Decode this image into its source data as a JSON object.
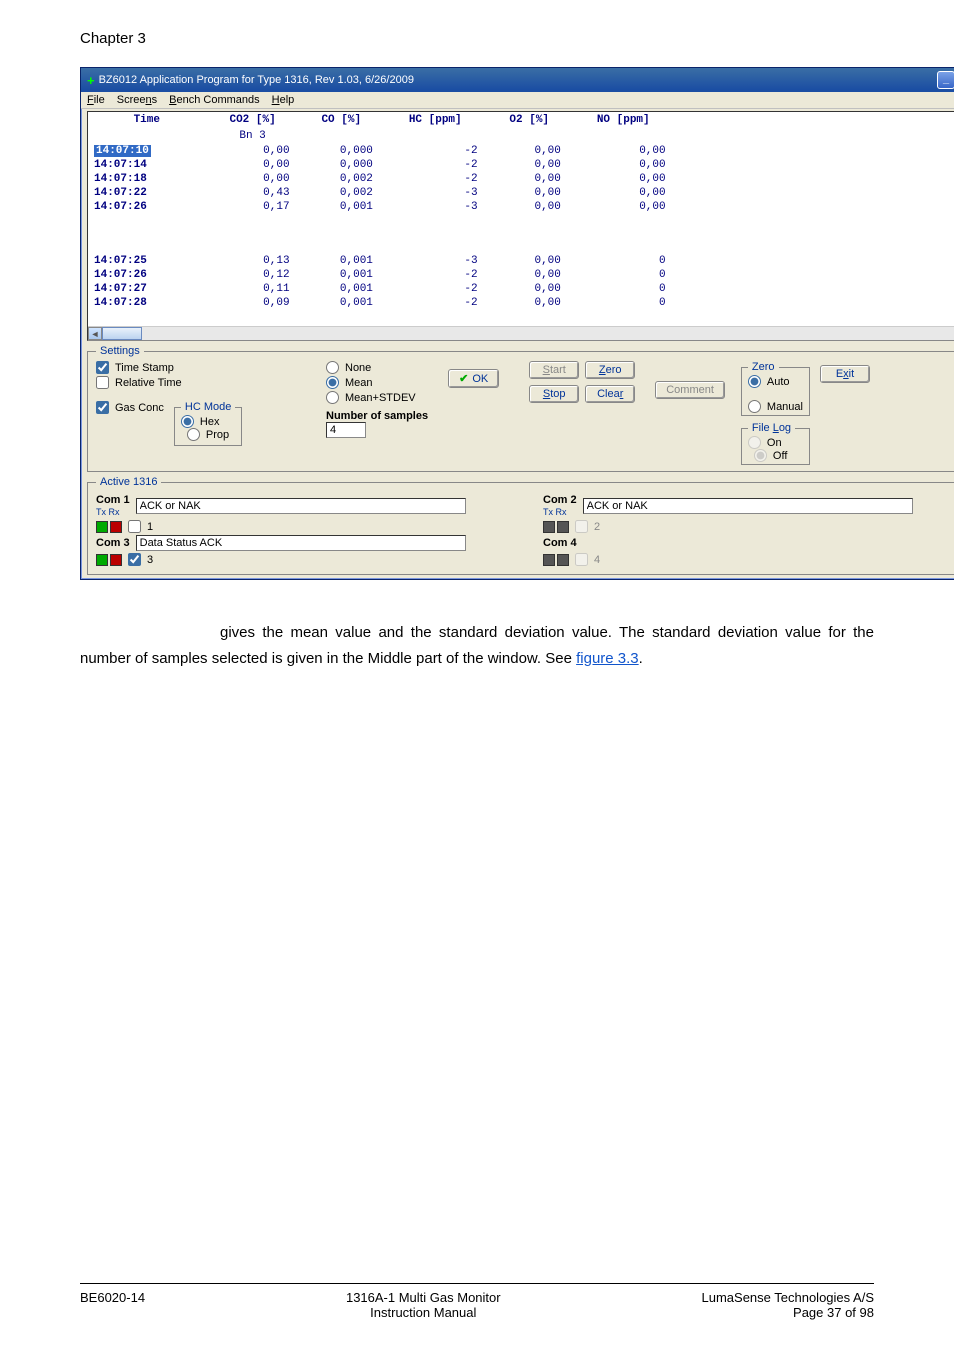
{
  "chapter_label": "Chapter 3",
  "window": {
    "title": "BZ6012 Application Program for Type 1316, Rev 1.03, 6/26/2009",
    "menu": {
      "file": "File",
      "screens": "Screens",
      "bench": "Bench Commands",
      "help": "Help"
    }
  },
  "grid": {
    "headers": {
      "time": "Time",
      "co2": "CO2 [%]",
      "co2sub": "Bn 3",
      "co": "CO [%]",
      "hc": "HC [ppm]",
      "o2": "O2 [%]",
      "no": "NO [ppm]"
    },
    "rows_top": [
      {
        "time": "14:07:10",
        "sel": true,
        "co2": "0,00",
        "co": "0,000",
        "hc": "-2",
        "o2": "0,00",
        "no": "0,00"
      },
      {
        "time": "14:07:14",
        "sel": false,
        "co2": "0,00",
        "co": "0,000",
        "hc": "-2",
        "o2": "0,00",
        "no": "0,00"
      },
      {
        "time": "14:07:18",
        "sel": false,
        "co2": "0,00",
        "co": "0,002",
        "hc": "-2",
        "o2": "0,00",
        "no": "0,00"
      },
      {
        "time": "14:07:22",
        "sel": false,
        "co2": "0,43",
        "co": "0,002",
        "hc": "-3",
        "o2": "0,00",
        "no": "0,00"
      },
      {
        "time": "14:07:26",
        "sel": false,
        "co2": "0,17",
        "co": "0,001",
        "hc": "-3",
        "o2": "0,00",
        "no": "0,00"
      }
    ],
    "rows_bottom": [
      {
        "time": "14:07:25",
        "co2": "0,13",
        "co": "0,001",
        "hc": "-3",
        "o2": "0,00",
        "no": "0"
      },
      {
        "time": "14:07:26",
        "co2": "0,12",
        "co": "0,001",
        "hc": "-2",
        "o2": "0,00",
        "no": "0"
      },
      {
        "time": "14:07:27",
        "co2": "0,11",
        "co": "0,001",
        "hc": "-2",
        "o2": "0,00",
        "no": "0"
      },
      {
        "time": "14:07:28",
        "co2": "0,09",
        "co": "0,001",
        "hc": "-2",
        "o2": "0,00",
        "no": "0"
      }
    ]
  },
  "settings": {
    "legend": "Settings",
    "time_stamp": "Time Stamp",
    "relative_time": "Relative Time",
    "gas_conc": "Gas Conc",
    "hc_mode": {
      "legend": "HC Mode",
      "hex": "Hex",
      "prop": "Prop"
    },
    "meanopts": {
      "none": "None",
      "mean": "Mean",
      "meanstdev": "Mean+STDEV"
    },
    "numsamples_label": "Number of samples",
    "numsamples_value": "4",
    "ok": "OK",
    "btns": {
      "start": "Start",
      "stop": "Stop",
      "zero": "Zero",
      "clear": "Clear",
      "comment": "Comment",
      "exit": "Exit"
    },
    "zero": {
      "legend": "Zero",
      "auto": "Auto",
      "manual": "Manual"
    },
    "filelog": {
      "legend": "File Log",
      "on": "On",
      "off": "Off"
    }
  },
  "active": {
    "legend": "Active 1316",
    "com1": "Com 1",
    "com2": "Com 2",
    "com3": "Com 3",
    "com4": "Com 4",
    "txrx": "Tx Rx",
    "acknak": "ACK or NAK",
    "datastatus": "Data Status ACK",
    "n1": "1",
    "n2": "2",
    "n3": "3",
    "n4": "4"
  },
  "paragraph": {
    "l1a": "gives the mean value and the standard deviation value. The standard deviation value for the number of samples selected is given in the Middle part of the window. See ",
    "link": "figure 3.3",
    "l1b": "."
  },
  "footer": {
    "left": "BE6020-14",
    "mid1": "1316A-1 Multi Gas Monitor",
    "mid2": "Instruction Manual",
    "right1": "LumaSense Technologies A/S",
    "right2": "Page 37 of 98"
  }
}
